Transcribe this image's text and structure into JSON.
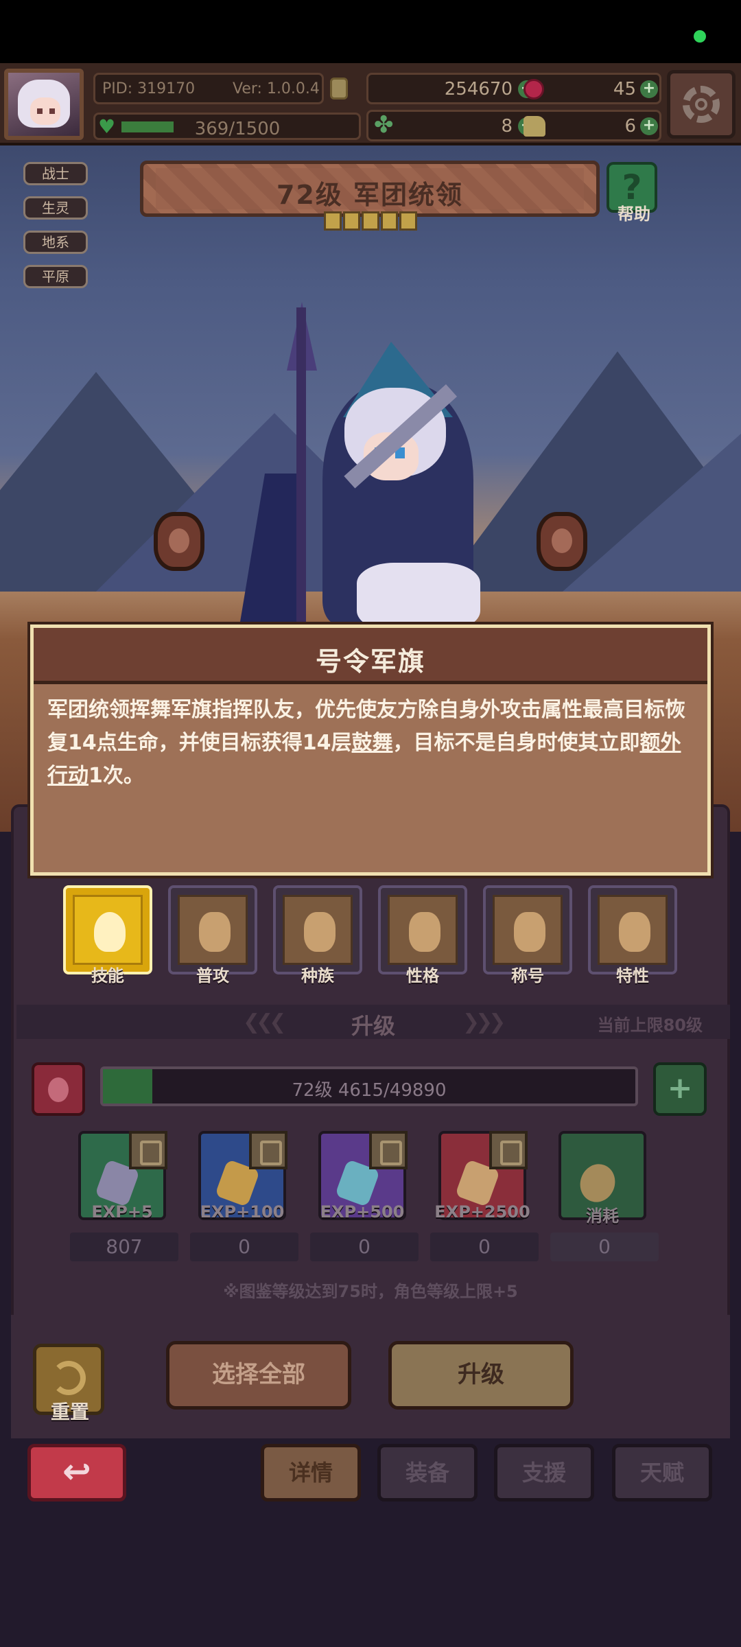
{
  "hud": {
    "pid": "PID: 319170",
    "version": "Ver: 1.0.0.4",
    "hp_text": "369/1500",
    "hp_ratio": 0.246,
    "gold": "254670",
    "gems": "45",
    "clover": "8",
    "hand_tokens": "6"
  },
  "tags": [
    "战士",
    "生灵",
    "地系",
    "平原"
  ],
  "character": {
    "title": "72级  军团统领",
    "stars": 5,
    "help_label": "帮助"
  },
  "skill_popup": {
    "title": "号令军旗",
    "desc_part1": "军团统领挥舞军旗指挥队友，优先使友方除自身外攻击属性最高目标恢复14点生命，并使目标获得14层",
    "desc_link1": "鼓舞",
    "desc_part2": "，目标不是自身时使其立即",
    "desc_link2": "额外行动",
    "desc_part3": "1次。"
  },
  "tabs": [
    {
      "label": "技能",
      "active": true
    },
    {
      "label": "普攻",
      "active": false
    },
    {
      "label": "种族",
      "active": false
    },
    {
      "label": "性格",
      "active": false
    },
    {
      "label": "称号",
      "active": false
    },
    {
      "label": "特性",
      "active": false
    }
  ],
  "upgrade": {
    "section_title": "升级",
    "limit_text": "当前上限80级",
    "exp_text": "72级  4615/49890",
    "exp_ratio": 0.0925
  },
  "items": [
    {
      "label": "EXP+5",
      "count": "807",
      "color": "#2e6a4a",
      "gem": "#8a86a6"
    },
    {
      "label": "EXP+100",
      "count": "0",
      "color": "#2e4a8a",
      "gem": "#c49a4a"
    },
    {
      "label": "EXP+500",
      "count": "0",
      "color": "#5a3a8a",
      "gem": "#6ab0c0"
    },
    {
      "label": "EXP+2500",
      "count": "0",
      "color": "#8a2e3a",
      "gem": "#c8a070"
    },
    {
      "label": "消耗",
      "count": "0",
      "color": "#2e5a3e",
      "gem": "#a48a5a"
    }
  ],
  "note": "※图鉴等级达到75时，角色等级上限+5",
  "actions": {
    "reset_label": "重置",
    "select_all": "选择全部",
    "upgrade": "升级"
  },
  "nav": {
    "back": "↩",
    "tabs": [
      {
        "label": "详情",
        "active": true
      },
      {
        "label": "装备",
        "active": false
      },
      {
        "label": "支援",
        "active": false
      },
      {
        "label": "天赋",
        "active": false
      }
    ]
  }
}
